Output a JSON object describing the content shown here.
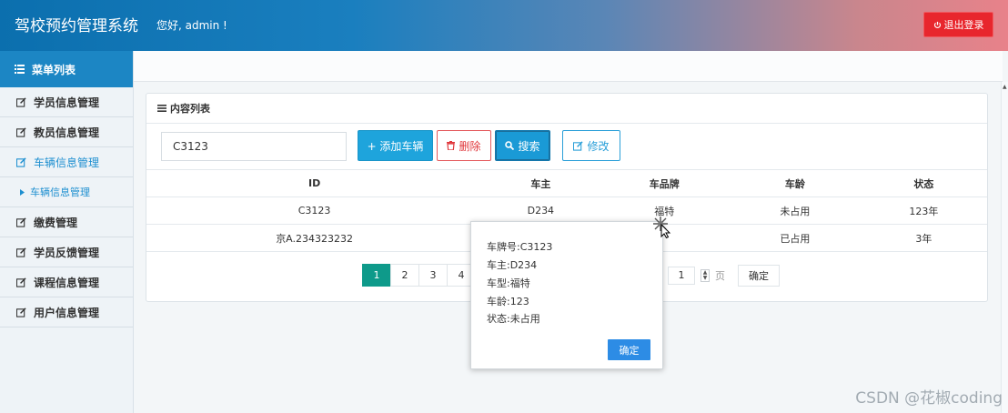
{
  "header": {
    "title": "驾校预约管理系统",
    "greeting": "您好, admin !",
    "logout_label": "退出登录"
  },
  "sidebar": {
    "head": "菜单列表",
    "items": [
      {
        "label": "学员信息管理"
      },
      {
        "label": "教员信息管理"
      },
      {
        "label": "车辆信息管理"
      },
      {
        "label": "车辆信息管理"
      },
      {
        "label": "缴费管理"
      },
      {
        "label": "学员反馈管理"
      },
      {
        "label": "课程信息管理"
      },
      {
        "label": "用户信息管理"
      }
    ]
  },
  "panel": {
    "title": "内容列表",
    "search_value": "C3123",
    "buttons": {
      "add": "+ 添加车辆",
      "delete": "删除",
      "search": "搜索",
      "edit": "修改"
    },
    "columns": [
      "ID",
      "车主",
      "车品牌",
      "车龄",
      "状态"
    ],
    "rows": [
      [
        "C3123",
        "D234",
        "福特",
        "未占用",
        "123年"
      ],
      [
        "京A.234323232",
        "",
        "",
        "已占用",
        "3年"
      ]
    ],
    "pager": {
      "pages": [
        "1",
        "2",
        "3",
        "4"
      ],
      "goto_value": "1",
      "page_unit": "页",
      "confirm": "确定"
    }
  },
  "dialog": {
    "lines": [
      "车牌号:C3123",
      "车主:D234",
      "车型:福特",
      "车龄:123",
      "状态:未占用"
    ],
    "ok": "确定"
  },
  "watermark": "CSDN @花椒coding",
  "colors": {
    "header_blue": "#0b6fae",
    "accent": "#1ea4dc",
    "danger": "#e8262d",
    "pager_active": "#0e9a8a"
  }
}
